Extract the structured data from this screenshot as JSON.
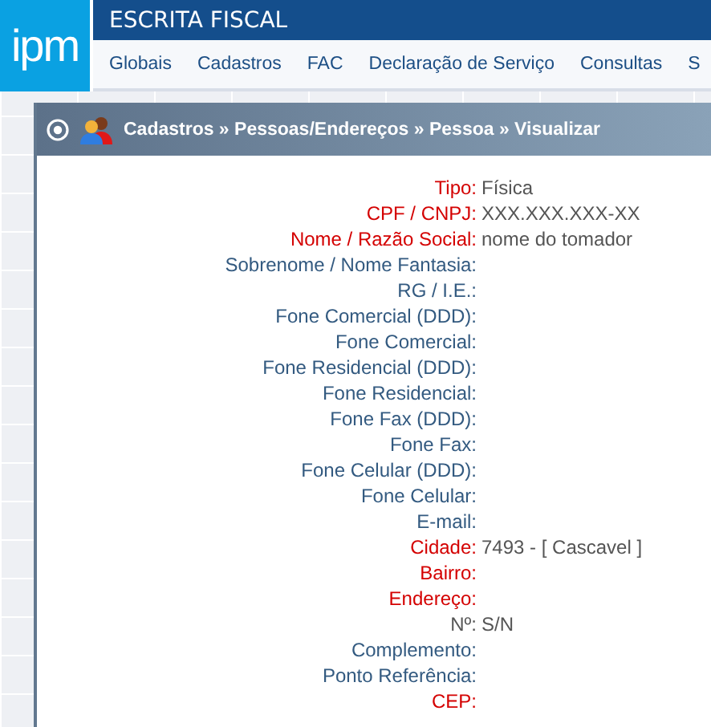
{
  "logo": {
    "text": "ipm"
  },
  "app_title": "ESCRITA FISCAL",
  "menu": [
    {
      "label": "Globais"
    },
    {
      "label": "Cadastros"
    },
    {
      "label": "FAC"
    },
    {
      "label": "Declaração de Serviço"
    },
    {
      "label": "Consultas"
    },
    {
      "label": "S"
    }
  ],
  "panel": {
    "breadcrumb": "Cadastros » Pessoas/Endereços » Pessoa » Visualizar",
    "fields": [
      {
        "label": "Tipo:",
        "value": "Física",
        "kind": "required"
      },
      {
        "label": "CPF / CNPJ:",
        "value": "XXX.XXX.XXX-XX",
        "kind": "required"
      },
      {
        "label": "Nome / Razão Social:",
        "value": "nome do tomador",
        "kind": "required"
      },
      {
        "label": "Sobrenome / Nome Fantasia:",
        "kind": "optional"
      },
      {
        "label": "RG / I.E.:",
        "kind": "optional"
      },
      {
        "label": "Fone Comercial (DDD):",
        "kind": "optional"
      },
      {
        "label": "Fone Comercial:",
        "kind": "optional"
      },
      {
        "label": "Fone Residencial (DDD):",
        "kind": "optional"
      },
      {
        "label": "Fone Residencial:",
        "kind": "optional"
      },
      {
        "label": "Fone Fax (DDD):",
        "kind": "optional"
      },
      {
        "label": "Fone Fax:",
        "kind": "optional"
      },
      {
        "label": "Fone Celular (DDD):",
        "kind": "optional"
      },
      {
        "label": "Fone Celular:",
        "kind": "optional"
      },
      {
        "label": "E-mail:",
        "kind": "optional"
      },
      {
        "label": "Cidade:",
        "value": "7493 - [ Cascavel ]",
        "kind": "required"
      },
      {
        "label": "Bairro:",
        "kind": "required"
      },
      {
        "label": "Endereço:",
        "kind": "required"
      },
      {
        "label": "Nº:",
        "value": "S/N",
        "kind": "plain"
      },
      {
        "label": "Complemento:",
        "kind": "optional"
      },
      {
        "label": "Ponto Referência:",
        "kind": "optional"
      },
      {
        "label": "CEP:",
        "kind": "required"
      }
    ]
  }
}
